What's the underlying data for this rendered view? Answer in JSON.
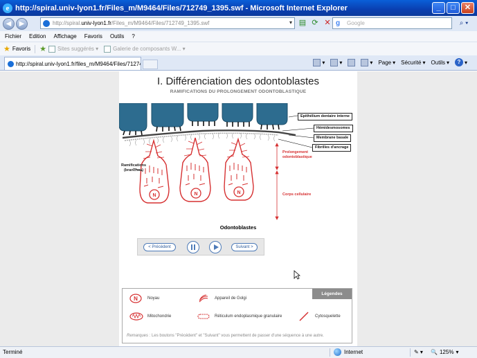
{
  "window": {
    "title": "http://spiral.univ-lyon1.fr/Files_m/M9464/Files/712749_1395.swf - Microsoft Internet Explorer"
  },
  "address_bar": {
    "url_prefix": "http://spiral.",
    "url_host": "univ-lyon1.fr",
    "url_rest": "/Files_m/M9464/Files/712749_1395.swf",
    "search_placeholder": "Google"
  },
  "menu": [
    "Fichier",
    "Edition",
    "Affichage",
    "Favoris",
    "Outils",
    "?"
  ],
  "favorites_bar": {
    "favorites_label": "Favoris",
    "items": [
      "Sites suggérés ▾",
      "Galerie de composants W... ▾"
    ]
  },
  "tab": {
    "label": "http://spiral.univ-lyon1.fr/files_m/M9464/Files/71274..."
  },
  "command_bar": {
    "page": "Page",
    "security": "Sécurité",
    "tools": "Outils"
  },
  "slide": {
    "title": "I. Différenciation des odontoblastes",
    "subtitle": "RAMIFICATIONS DU PROLONGEMENT ODONTOBLASTIQUE",
    "labels": {
      "epithelium": "Epithélium dentaire interne",
      "hemidesmosomes": "Hémidesmosomes",
      "membrane": "Membrane basale",
      "fibrilles": "Fibrilles d'ancrage",
      "ramifications": "Ramifications\n(branches)",
      "prolongement": "Prolongement\nodontoblastique",
      "corps": "Corps cellulaire",
      "odontoblastes": "Odontoblastes"
    },
    "nav": {
      "prev": "< Précédent",
      "next": "Suivant >"
    },
    "legend": {
      "title": "Légendes",
      "items": {
        "noyau": "Noyau",
        "golgi": "Appareil de Golgi",
        "mito": "Mitochondrie",
        "reticulum": "Réticulum endoplasmique granulaire",
        "cyto": "Cytosquelette"
      },
      "remark_label": "Remarques",
      "remark": " : Les boutons \"Précédent\" et \"Suivant\" vous permettent de passer d'une séquence à une autre."
    }
  },
  "status": {
    "left": "Terminé",
    "zone": "Internet",
    "zoom": "125%"
  },
  "colors": {
    "accent_red": "#d63031",
    "cell_blue": "#2d6c8f",
    "titlebar": "#0a4fc8"
  }
}
